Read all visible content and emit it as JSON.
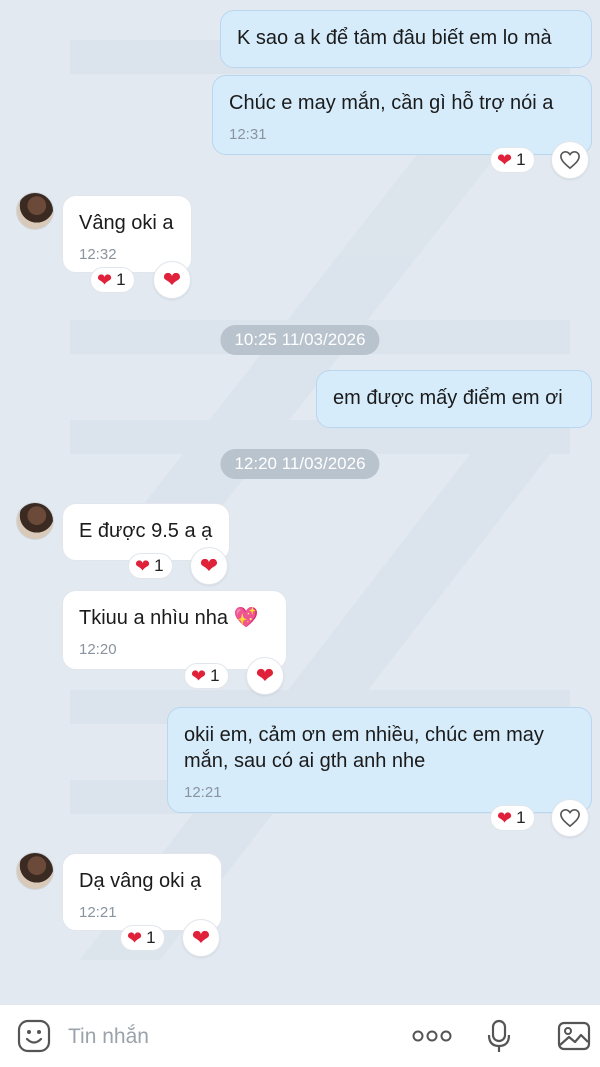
{
  "colors": {
    "mine_bubble": "#d6ecfb",
    "their_bubble": "#ffffff",
    "heart": "#e0213a",
    "timestamp_pill": "#b8c3cd"
  },
  "messages": [
    {
      "side": "mine",
      "text": "K sao a k để tâm đâu biết em lo mà"
    },
    {
      "side": "mine",
      "text": "Chúc e may mắn, cần gì hỗ trợ nói a",
      "time": "12:31",
      "reaction_count": "1"
    },
    {
      "side": "theirs",
      "text": "Vâng oki a",
      "time": "12:32",
      "reaction_count": "1"
    },
    {
      "side": "mine",
      "text": "em được mấy điểm em ơi"
    },
    {
      "side": "theirs",
      "text": "E được 9.5 a ạ",
      "reaction_count": "1"
    },
    {
      "side": "theirs",
      "text": "Tkiuu a nhìu nha 💖",
      "time": "12:20",
      "reaction_count": "1"
    },
    {
      "side": "mine",
      "text": "okii em, cảm ơn em nhiều, chúc em may mắn, sau có ai gth anh nhe",
      "time": "12:21",
      "reaction_count": "1"
    },
    {
      "side": "theirs",
      "text": "Dạ vâng oki ạ",
      "time": "12:21",
      "reaction_count": "1"
    }
  ],
  "timestamps": [
    "10:25 11/03/2026",
    "12:20 11/03/2026"
  ],
  "composer": {
    "placeholder": "Tin nhắn",
    "icons": [
      "emoji-icon",
      "more-icon",
      "microphone-icon",
      "image-icon"
    ]
  }
}
